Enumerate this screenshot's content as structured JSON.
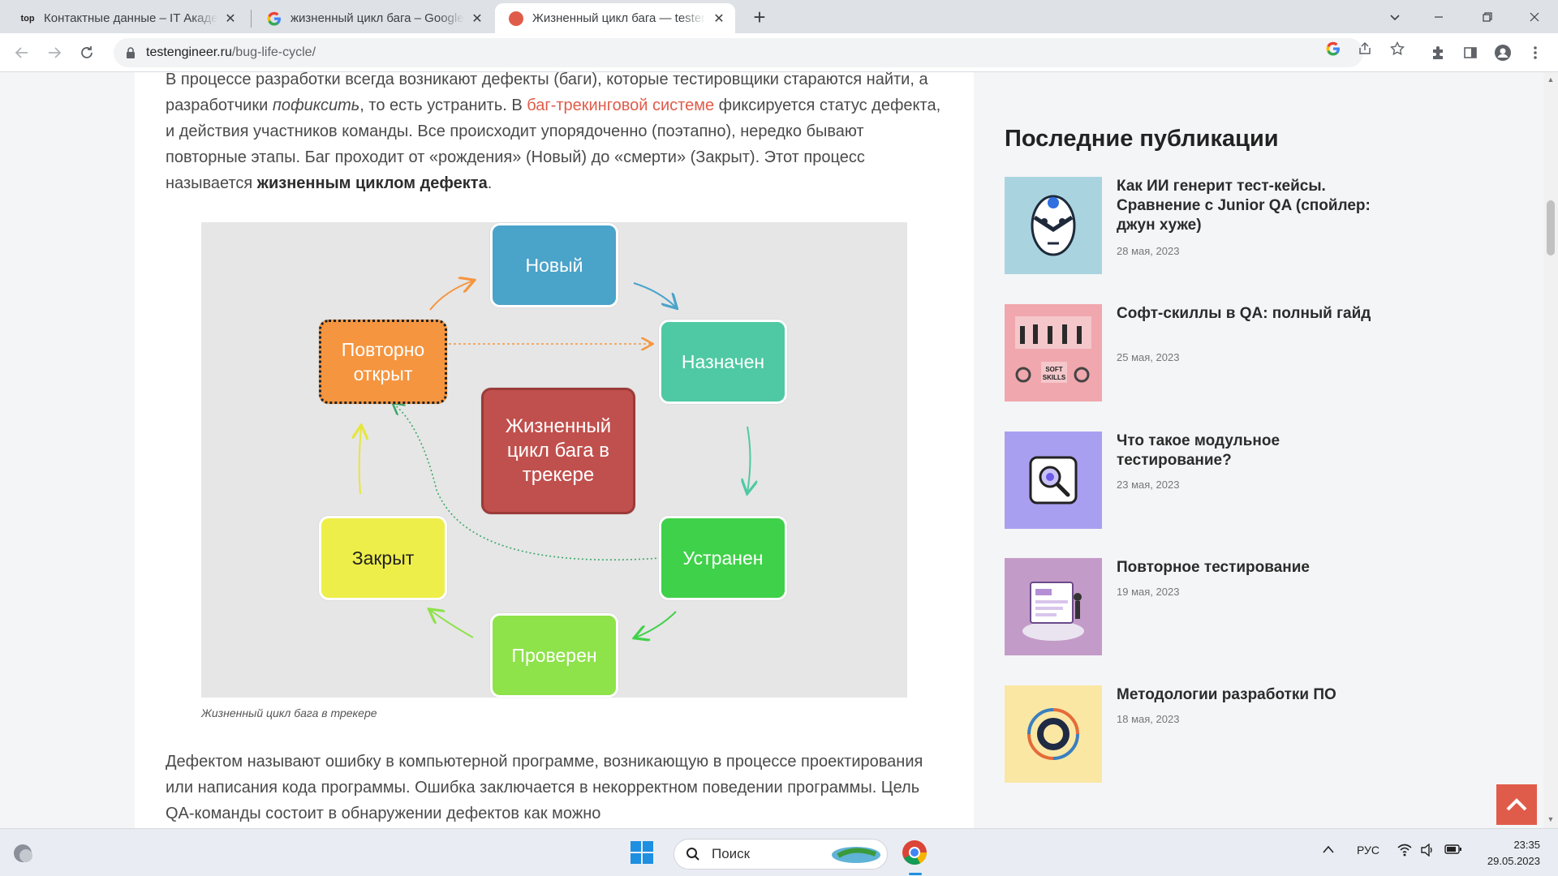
{
  "browser": {
    "tabs": [
      {
        "title": "Контактные данные – IT Академия",
        "favicon": "top-academy-favicon"
      },
      {
        "title": "жизненный цикл бага – Google Поиск",
        "favicon": "google-favicon"
      },
      {
        "title": "Жизненный цикл бага — testengineer",
        "favicon": "site-favicon",
        "active": true
      }
    ],
    "url_domain": "testengineer.ru",
    "url_path": "/bug-life-cycle/"
  },
  "article": {
    "intro": {
      "part1": "В процессе разработки всегда возникают дефекты (баги), которые тестировщики стараются найти, а разработчики ",
      "italic": "пофиксить",
      "part2": ", то есть устранить. В ",
      "link": "баг-трекинговой системе",
      "part3": " фиксируется статус дефекта, и действия участников команды. Все происходит упорядоченно (поэтапно), нередко бывают повторные этапы. Баг проходит от «рождения» (Новый) до «смерти» (Закрыт). Этот процесс называется ",
      "bold": "жизненным циклом дефекта",
      "end": "."
    },
    "diagram": {
      "nodes": {
        "new": "Новый",
        "assigned": "Назначен",
        "fixed": "Устранен",
        "verified": "Проверен",
        "closed": "Закрыт",
        "reopened": "Повторно открыт",
        "center": "Жизненный цикл бага в трекере"
      },
      "colors": {
        "new": "#4aa3c9",
        "assigned": "#4fc9a3",
        "fixed": "#3fd14a",
        "verified": "#8ee24a",
        "closed": "#eeee4a",
        "reopened": "#f5953f",
        "center": "#c0504d"
      }
    },
    "caption": "Жизненный цикл бага в трекере",
    "para2": "Дефектом называют ошибку в компьютерной программе, возникающую в процессе проектирования или написания кода программы. Ошибка заключается в некорректном поведении программы. Цель QA-команды состоит в обнаружении дефектов как можно"
  },
  "sidebar": {
    "title": "Последние публикации",
    "posts": [
      {
        "title": "Как ИИ генерит тест-кейсы. Сравнение с Junior QA (спойлер: джун хуже)",
        "date": "28 мая, 2023",
        "thumb_icon": "robot-icon",
        "thumb_color": "#a9d4df"
      },
      {
        "title": "Софт-скиллы в QA: полный гайд",
        "date": "25 мая, 2023",
        "thumb_icon": "soft-skills-icon",
        "thumb_color": "#f0a7ad"
      },
      {
        "title": "Что такое модульное тестирование?",
        "date": "23 мая, 2023",
        "thumb_icon": "magnifier-icon",
        "thumb_color": "#a99ff0"
      },
      {
        "title": "Повторное тестирование",
        "date": "19 мая, 2023",
        "thumb_icon": "dashboard-icon",
        "thumb_color": "#c39bc8"
      },
      {
        "title": "Методологии разработки ПО",
        "date": "18 мая, 2023",
        "thumb_icon": "cycle-icon",
        "thumb_color": "#fbe7a4"
      }
    ]
  },
  "taskbar": {
    "search_label": "Поиск",
    "language": "РУС",
    "time": "23:35",
    "date": "29.05.2023"
  }
}
